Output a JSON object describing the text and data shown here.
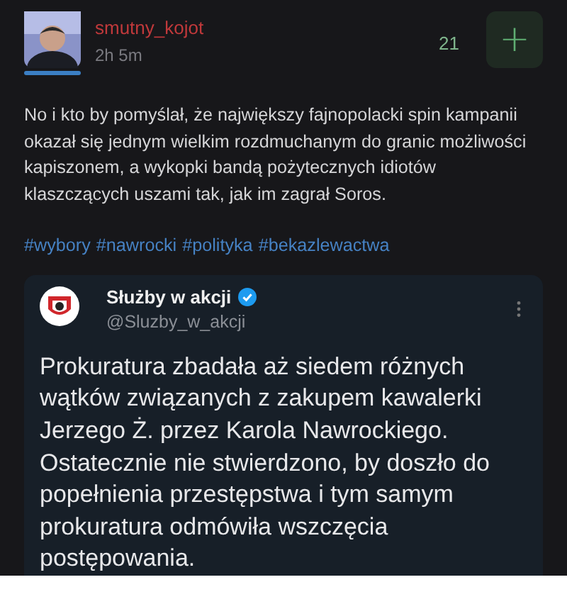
{
  "post": {
    "author": "smutny_kojot",
    "time": "2h 5m",
    "votes": "21",
    "vote_button": "+",
    "text": "No i kto by pomyślał, że największy fajnopolacki spin kampanii okazał się jednym wielkim rozdmuchanym do granic możliwości kapiszonem, a wykopki bandą pożytecznych idiotów klaszczących uszami tak, jak im zagrał Soros.",
    "tags": [
      "#wybory",
      "#nawrocki",
      "#polityka",
      "#bekazlewactwa"
    ]
  },
  "embed": {
    "name": "Służby w akcji",
    "verified": true,
    "handle": "@Sluzby_w_akcji",
    "text": "Prokuratura zbadała aż siedem różnych wątków związanych z zakupem kawalerki Jerzego Ż. przez Karola Nawrockiego. Ostatecznie nie stwierdzono, by doszło do popełnienia przestępstwa i tym samym prokuratura odmówiła wszczęcia postępowania."
  }
}
